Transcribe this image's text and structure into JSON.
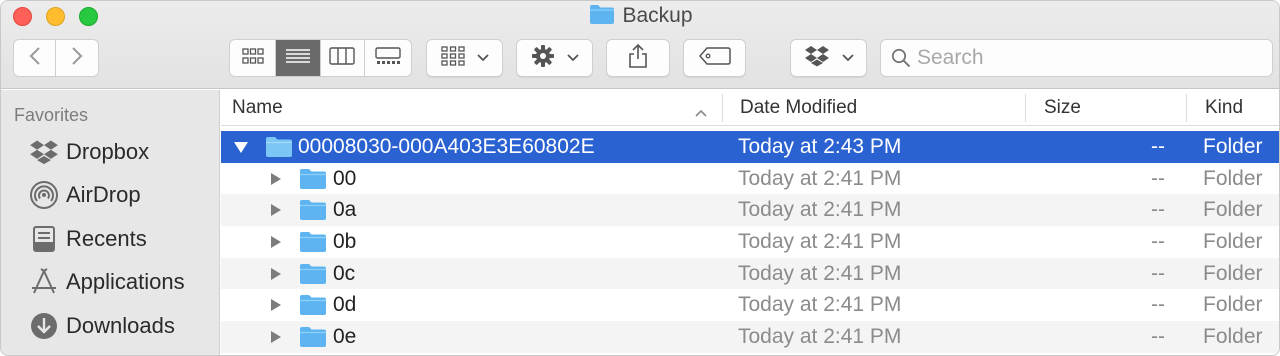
{
  "window": {
    "title": "Backup"
  },
  "toolbar": {
    "back_icon": "chevron-left-icon",
    "forward_icon": "chevron-right-icon",
    "view_modes": [
      "icon-view-icon",
      "list-view-icon",
      "column-view-icon",
      "gallery-view-icon"
    ],
    "active_view": "list",
    "group_icon": "group-by-icon",
    "action_icon": "gear-icon",
    "share_icon": "share-icon",
    "tag_icon": "tag-icon",
    "dropbox_icon": "dropbox-icon"
  },
  "search": {
    "placeholder": "Search",
    "value": ""
  },
  "sidebar": {
    "section_label": "Favorites",
    "items": [
      {
        "label": "Dropbox",
        "icon": "dropbox-icon"
      },
      {
        "label": "AirDrop",
        "icon": "airdrop-icon"
      },
      {
        "label": "Recents",
        "icon": "recents-icon"
      },
      {
        "label": "Applications",
        "icon": "applications-icon"
      },
      {
        "label": "Downloads",
        "icon": "downloads-icon"
      }
    ]
  },
  "columns": {
    "name": "Name",
    "date_modified": "Date Modified",
    "size": "Size",
    "kind": "Kind"
  },
  "files": [
    {
      "name": "00008030-000A403E3E60802E",
      "date": "Today at 2:43 PM",
      "size": "--",
      "kind": "Folder",
      "expanded": true,
      "selected": true
    },
    {
      "name": "00",
      "date": "Today at 2:41 PM",
      "size": "--",
      "kind": "Folder"
    },
    {
      "name": "0a",
      "date": "Today at 2:41 PM",
      "size": "--",
      "kind": "Folder"
    },
    {
      "name": "0b",
      "date": "Today at 2:41 PM",
      "size": "--",
      "kind": "Folder"
    },
    {
      "name": "0c",
      "date": "Today at 2:41 PM",
      "size": "--",
      "kind": "Folder"
    },
    {
      "name": "0d",
      "date": "Today at 2:41 PM",
      "size": "--",
      "kind": "Folder"
    },
    {
      "name": "0e",
      "date": "Today at 2:41 PM",
      "size": "--",
      "kind": "Folder"
    }
  ],
  "colors": {
    "selection": "#2b62d2",
    "folder": "#5eb4f0",
    "sidebar_bg": "#e7e7e7"
  }
}
